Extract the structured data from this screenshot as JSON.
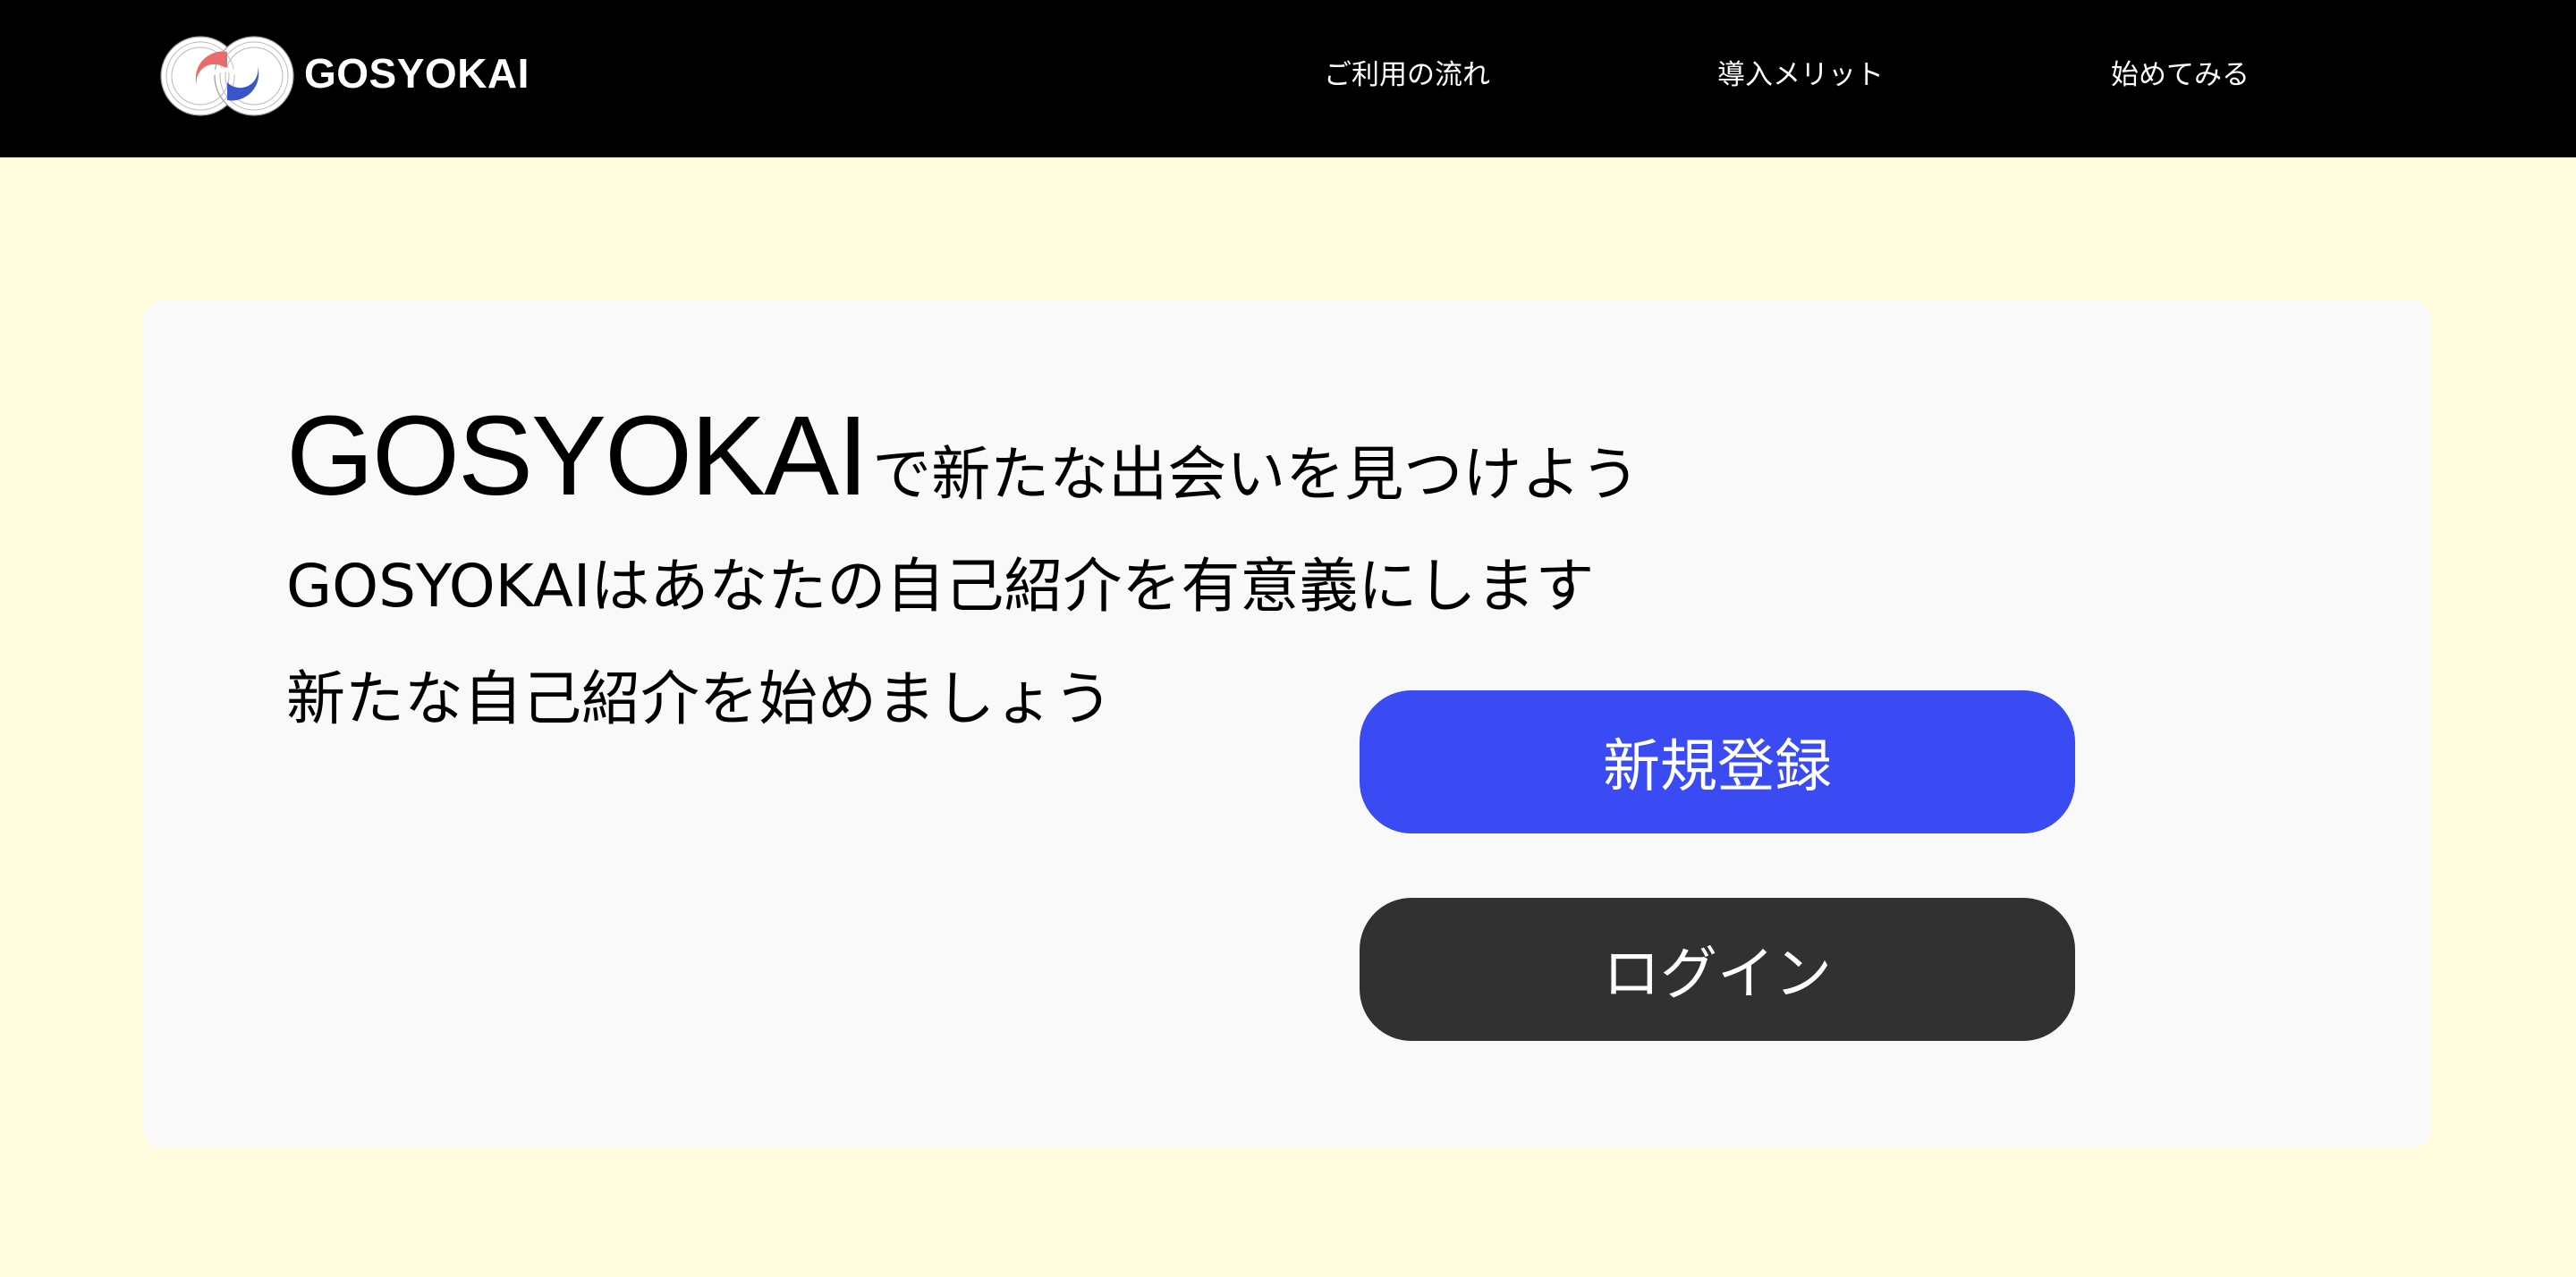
{
  "header": {
    "brand": "GOSYOKAI",
    "nav": [
      {
        "label": "ご利用の流れ"
      },
      {
        "label": "導入メリット"
      },
      {
        "label": "始めてみる"
      }
    ]
  },
  "hero": {
    "title_brand": "GOSYOKAI",
    "title_rest": "で新たな出会いを見つけよう",
    "line2": "GOSYOKAIはあなたの自己紹介を有意義にします",
    "line3": "新たな自己紹介を始めましょう",
    "register_label": "新規登録",
    "login_label": "ログイン"
  },
  "colors": {
    "page_background": "#FFFDDE",
    "header_background": "#000000",
    "card_background": "#F9F9F9",
    "register_button": "#3A4BF4",
    "login_button": "#313131",
    "logo_red": "#E96C6C",
    "logo_blue": "#3A55C9"
  },
  "icons": {
    "logo": "gosyokai-logo-icon"
  }
}
